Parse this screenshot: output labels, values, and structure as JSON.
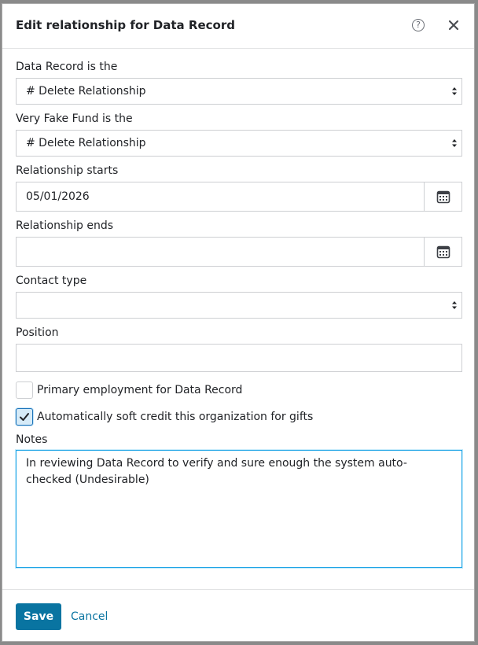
{
  "dialog": {
    "title": "Edit relationship for Data Record",
    "help_icon": "question-circle-icon",
    "help_glyph": "?",
    "close_icon": "close-icon"
  },
  "form": {
    "record_role_label": "Data Record is the",
    "record_role_value": "# Delete Relationship",
    "fund_role_label": "Very Fake Fund is the",
    "fund_role_value": "# Delete Relationship",
    "start_label": "Relationship starts",
    "start_value": "05/01/2026",
    "end_label": "Relationship ends",
    "end_value": "",
    "contact_type_label": "Contact type",
    "contact_type_value": "",
    "position_label": "Position",
    "position_value": "",
    "primary_employment_label": "Primary employment for Data Record",
    "primary_employment_checked": false,
    "soft_credit_label": "Automatically soft credit this organization for gifts",
    "soft_credit_checked": true,
    "notes_label": "Notes",
    "notes_value": "In reviewing Data Record to verify and sure enough the system auto-checked (Undesirable)"
  },
  "footer": {
    "save_label": "Save",
    "cancel_label": "Cancel"
  },
  "colors": {
    "primary": "#0974a1",
    "focus": "#1ea4e6"
  }
}
